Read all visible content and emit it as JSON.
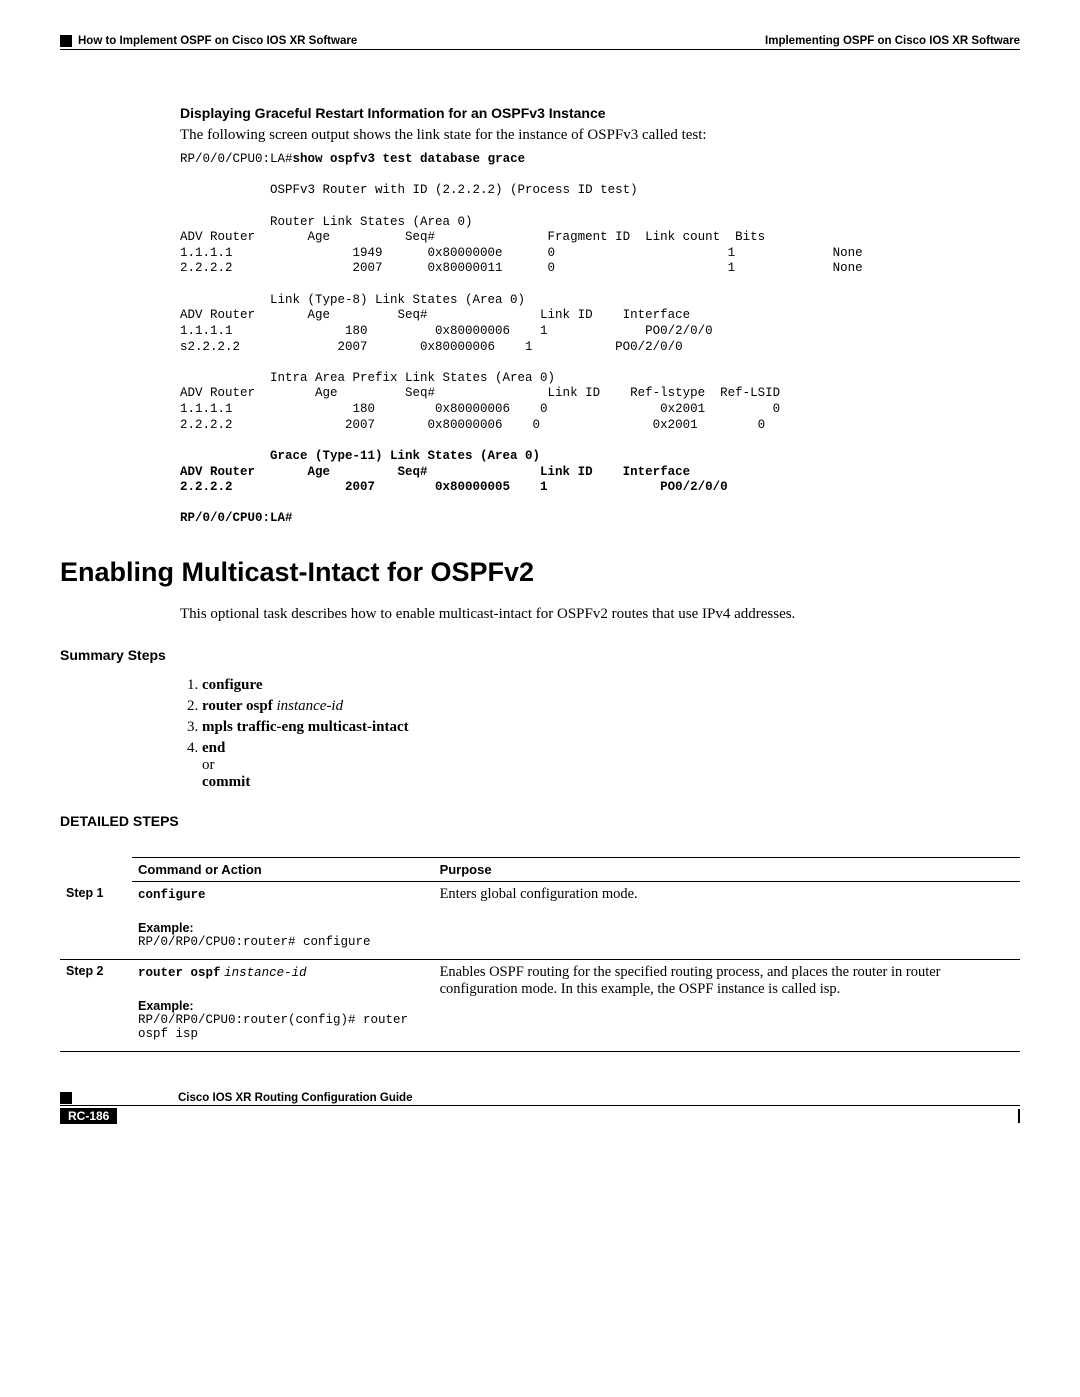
{
  "header": {
    "section": "How to Implement OSPF on Cisco IOS XR Software",
    "chapter": "Implementing OSPF on Cisco IOS XR Software"
  },
  "graceful": {
    "heading": "Displaying Graceful Restart Information for an OSPFv3 Instance",
    "intro": "The following screen output shows the link state for the instance of OSPFv3 called test:",
    "prompt_prefix": "RP/0/0/CPU0:LA#",
    "command": "show ospfv3 test database grace",
    "router_id_line": "            OSPFv3 Router with ID (2.2.2.2) (Process ID test)",
    "sec1_title": "            Router Link States (Area 0)",
    "sec1_header": "ADV Router       Age          Seq#               Fragment ID  Link count  Bits",
    "sec1_rows": [
      "1.1.1.1                1949      0x8000000e      0                       1             None",
      "2.2.2.2                2007      0x80000011      0                       1             None"
    ],
    "sec2_title": "            Link (Type-8) Link States (Area 0)",
    "sec2_header": "ADV Router       Age         Seq#               Link ID    Interface",
    "sec2_rows": [
      "1.1.1.1               180         0x80000006    1             PO0/2/0/0",
      "s2.2.2.2             2007       0x80000006    1           PO0/2/0/0"
    ],
    "sec3_title": "            Intra Area Prefix Link States (Area 0)",
    "sec3_header": "ADV Router        Age         Seq#               Link ID    Ref-lstype  Ref-LSID",
    "sec3_rows": [
      "1.1.1.1                180        0x80000006    0               0x2001         0",
      "2.2.2.2               2007       0x80000006    0               0x2001        0"
    ],
    "sec4_title": "            Grace (Type-11) Link States (Area 0)",
    "sec4_header": "ADV Router       Age         Seq#               Link ID    Interface",
    "sec4_rows": [
      "2.2.2.2               2007        0x80000005    1               PO0/2/0/0"
    ],
    "trailing_prompt": "RP/0/0/CPU0:LA#"
  },
  "multicast": {
    "title": "Enabling Multicast-Intact for OSPFv2",
    "intro": "This optional task describes how to enable multicast-intact for OSPFv2 routes that use IPv4 addresses.",
    "summary_heading": "Summary Steps",
    "steps": {
      "s1": "configure",
      "s2a": "router ospf",
      "s2b": "instance-id",
      "s3": "mpls traffic-eng multicast-intact",
      "s4a": "end",
      "s4b": "or",
      "s4c": "commit"
    },
    "detailed_heading": "DETAILED STEPS",
    "table": {
      "col1": "Command or Action",
      "col2": "Purpose",
      "step1_label": "Step 1",
      "step1_cmd": "configure",
      "step1_example_label": "Example:",
      "step1_example": "RP/0/RP0/CPU0:router# configure",
      "step1_purpose": "Enters global configuration mode.",
      "step2_label": "Step 2",
      "step2_cmd_a": "router ospf",
      "step2_cmd_b": "instance-id",
      "step2_example_label": "Example:",
      "step2_example": "RP/0/RP0/CPU0:router(config)# router ospf isp",
      "step2_purpose": "Enables OSPF routing for the specified routing process, and places the router in router configuration mode. In this example, the OSPF instance is called isp."
    }
  },
  "footer": {
    "guide": "Cisco IOS XR Routing Configuration Guide",
    "page": "RC-186"
  }
}
